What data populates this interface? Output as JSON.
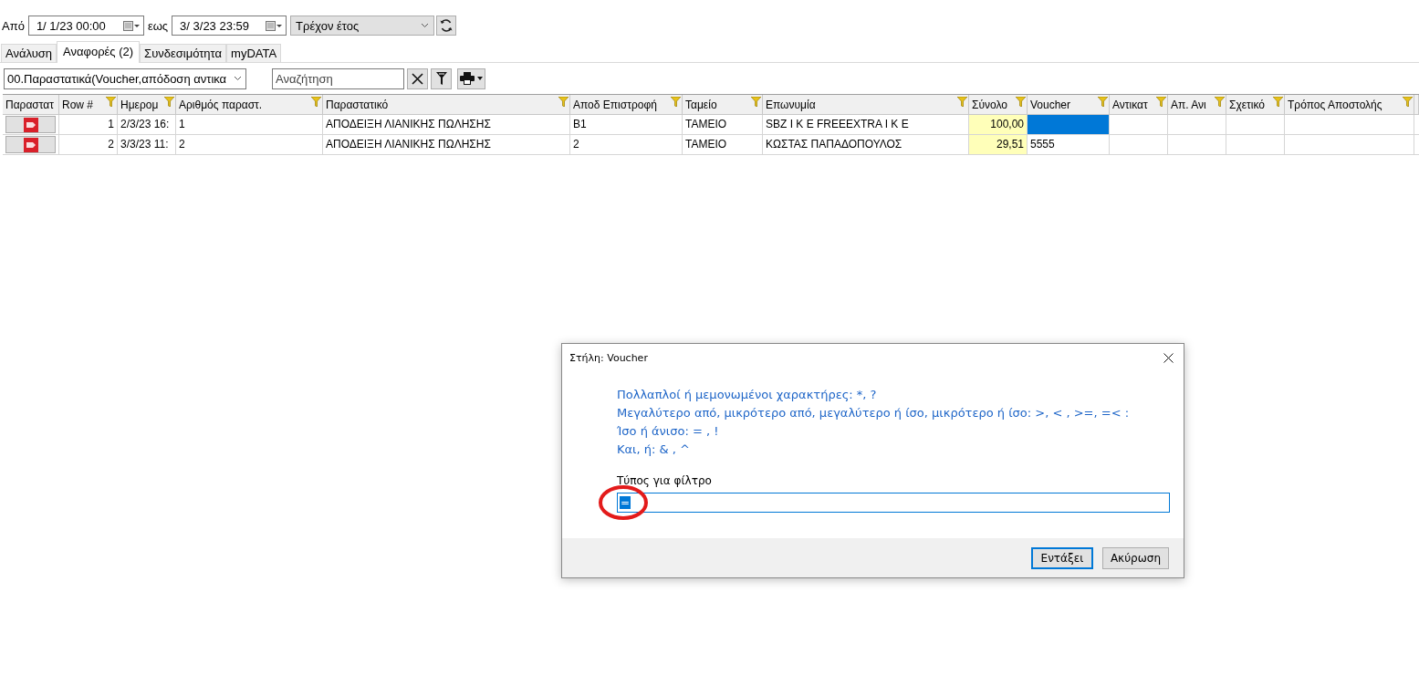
{
  "date_bar": {
    "from_label": "Από",
    "from_value": "1/  1/23 00:00",
    "to_label": "εως",
    "to_value": "3/  3/23 23:59",
    "period": "Τρέχον έτος"
  },
  "tabs": [
    {
      "label": "Ανάλυση",
      "selected": false
    },
    {
      "label": "Αναφορές (2)",
      "selected": true
    },
    {
      "label": "Συνδεσιμότητα",
      "selected": false
    },
    {
      "label": "myDATA",
      "selected": false
    }
  ],
  "toolbar": {
    "report": "00.Παραστατικά(Voucher,απόδοση αντικα",
    "search": {
      "placeholder": "Αναζήτηση"
    }
  },
  "table": {
    "columns": [
      {
        "label": "Παραστατ",
        "kind": "icon",
        "filterable": false
      },
      {
        "label": "Row #",
        "kind": "number",
        "filterable": true
      },
      {
        "label": "Ημερομ",
        "kind": "text",
        "filterable": true
      },
      {
        "label": "Αριθμός παραστ.",
        "kind": "text",
        "filterable": true
      },
      {
        "label": "Παραστατικό",
        "kind": "text",
        "filterable": true
      },
      {
        "label": "Αποδ Επιστροφή",
        "kind": "text",
        "filterable": true
      },
      {
        "label": "Ταμείο",
        "kind": "text",
        "filterable": true
      },
      {
        "label": "Επωνυμία",
        "kind": "text",
        "filterable": true
      },
      {
        "label": "Σύνολο",
        "kind": "amount",
        "filterable": true
      },
      {
        "label": "Voucher",
        "kind": "text",
        "filterable": true
      },
      {
        "label": "Αντικατ",
        "kind": "text",
        "filterable": true
      },
      {
        "label": "Απ. Ανι",
        "kind": "text",
        "filterable": true
      },
      {
        "label": "Σχετικό",
        "kind": "text",
        "filterable": true
      },
      {
        "label": "Τρόπος Αποστολής",
        "kind": "text",
        "filterable": true
      }
    ],
    "rows": [
      {
        "cells": [
          null,
          "1",
          "2/3/23 16:",
          "1",
          "ΑΠΟΔΕΙΞΗ ΛΙΑΝΙΚΗΣ ΠΩΛΗΣΗΣ",
          "B1",
          "ΤΑΜΕΙΟ",
          "SBZ I K E  FREEEXTRA I K E",
          "100,00",
          {
            "focused": true
          },
          null,
          null,
          null,
          null
        ]
      },
      {
        "cells": [
          null,
          "2",
          "3/3/23 11:",
          "2",
          "ΑΠΟΔΕΙΞΗ ΛΙΑΝΙΚΗΣ ΠΩΛΗΣΗΣ",
          "2",
          "ΤΑΜΕΙΟ",
          "ΚΩΣΤΑΣ ΠΑΠΑΔΟΠΟΥΛΟΣ",
          "29,51",
          "5555",
          null,
          null,
          null,
          null
        ]
      }
    ]
  },
  "dialog": {
    "title": "Στήλη: Voucher",
    "hints": [
      "Πολλαπλοί ή μεμονωμένοι χαρακτήρες: *, ?",
      "Μεγαλύτερο από, μικρότερο από, μεγαλύτερο ή ίσο, μικρότερο ή ίσο: >, < , >=, =< :",
      "Ίσο ή άνισο: = , !",
      "Και, ή: & , ^"
    ],
    "field": {
      "label": "Τύπος για φίλτρο",
      "value": "=",
      "value_selected": true,
      "circled": true
    },
    "buttons": [
      {
        "label": "Εντάξει",
        "default": true
      },
      {
        "label": "Ακύρωση",
        "default": false
      }
    ]
  }
}
